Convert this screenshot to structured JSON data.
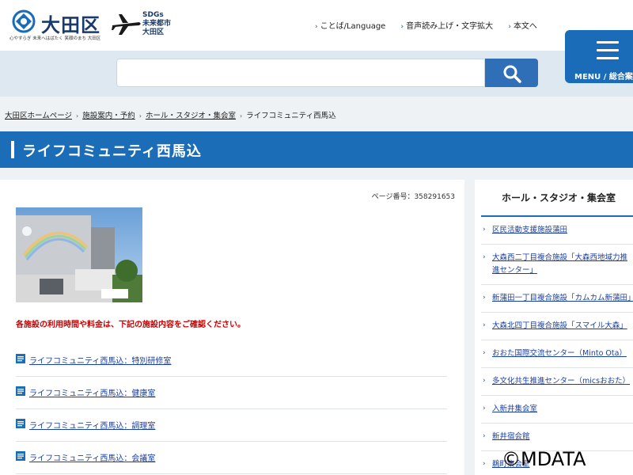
{
  "header": {
    "logo_title": "大田区",
    "logo_tagline": "心やすらぎ 未来へはばたく 笑顔のまち 大田区",
    "sdgs_line1": "SDGs",
    "sdgs_line2": "未来都市",
    "sdgs_line3": "大田区",
    "links": [
      {
        "label": "ことば/Language"
      },
      {
        "label": "音声読み上げ・文字拡大"
      },
      {
        "label": "本文へ"
      }
    ]
  },
  "search": {
    "placeholder": "",
    "value": ""
  },
  "menu": {
    "label": "MENU / 総合案内"
  },
  "breadcrumb": [
    {
      "label": "大田区ホームページ"
    },
    {
      "label": "施設案内・予約"
    },
    {
      "label": "ホール・スタジオ・集会室"
    },
    {
      "label": "ライフコミュニティ西馬込"
    }
  ],
  "page": {
    "title": "ライフコミュニティ西馬込",
    "page_number": "ページ番号：358291653",
    "notice": "各施設の利用時間や料金は、下記の施設内容をご確認ください。"
  },
  "facility_links": [
    {
      "label": "ライフコミュニティ西馬込：特別研修室"
    },
    {
      "label": "ライフコミュニティ西馬込：健康室"
    },
    {
      "label": "ライフコミュニティ西馬込：調理室"
    },
    {
      "label": "ライフコミュニティ西馬込：会議室"
    }
  ],
  "sidebar": {
    "heading": "ホール・スタジオ・集会室",
    "items": [
      {
        "label": "区民活動支援施設蒲田"
      },
      {
        "label": "大森西二丁目複合施設「大森西地域力推進センター」"
      },
      {
        "label": "新蒲田一丁目複合施設「カムカム新蒲田」"
      },
      {
        "label": "大森北四丁目複合施設「スマイル大森」"
      },
      {
        "label": "おおた国際交流センター（Minto Ota）"
      },
      {
        "label": "多文化共生推進センター（micsおおた）"
      },
      {
        "label": "入新井集会室"
      },
      {
        "label": "新井宿会館"
      },
      {
        "label": "鵜町集会室"
      }
    ]
  },
  "watermark": "©MDATA",
  "colors": {
    "brand_blue": "#1b6db7",
    "notice_red": "#cc0000",
    "link_blue": "#1a3fa3"
  }
}
